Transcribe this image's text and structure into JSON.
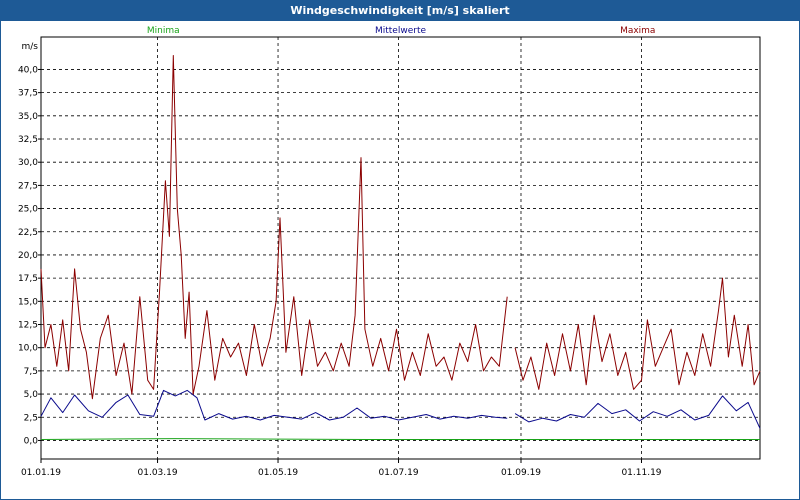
{
  "window": {
    "title": "Windgeschwindigkeit [m/s] skaliert"
  },
  "chart_data": {
    "type": "line",
    "title": "Windgeschwindigkeit [m/s] skaliert",
    "ylabel": "m/s",
    "xlabel": "",
    "ylim": [
      -2.0,
      43.5
    ],
    "xlim": [
      "2019-01-01",
      "2019-12-31"
    ],
    "yticks": [
      "0,0",
      "2,5",
      "5,0",
      "7,5",
      "10,0",
      "12,5",
      "15,0",
      "17,5",
      "20,0",
      "22,5",
      "25,0",
      "27,5",
      "30,0",
      "32,5",
      "35,0",
      "37,5",
      "40,0"
    ],
    "xticks": [
      {
        "date": "2019-01-01",
        "label": "01.01.19"
      },
      {
        "date": "2019-03-01",
        "label": "01.03.19"
      },
      {
        "date": "2019-05-01",
        "label": "01.05.19"
      },
      {
        "date": "2019-07-01",
        "label": "01.07.19"
      },
      {
        "date": "2019-09-01",
        "label": "01.09.19"
      },
      {
        "date": "2019-11-01",
        "label": "01.11.19"
      }
    ],
    "grid": true,
    "legend_placement": "top",
    "series": [
      {
        "name": "Minima",
        "color": "#1aa31a",
        "points": [
          [
            "2019-01-01",
            0.1
          ],
          [
            "2019-03-10",
            0.2
          ],
          [
            "2019-06-15",
            0.1
          ],
          [
            "2019-09-20",
            0.1
          ],
          [
            "2019-12-31",
            0.1
          ]
        ]
      },
      {
        "name": "Mittelwerte",
        "color": "#0a0a8c",
        "points": [
          [
            "2019-01-01",
            2.6
          ],
          [
            "2019-01-06",
            4.6
          ],
          [
            "2019-01-12",
            3.0
          ],
          [
            "2019-01-18",
            4.9
          ],
          [
            "2019-01-25",
            3.2
          ],
          [
            "2019-02-01",
            2.5
          ],
          [
            "2019-02-08",
            4.1
          ],
          [
            "2019-02-14",
            4.9
          ],
          [
            "2019-02-20",
            2.8
          ],
          [
            "2019-02-27",
            2.6
          ],
          [
            "2019-03-04",
            5.4
          ],
          [
            "2019-03-10",
            4.8
          ],
          [
            "2019-03-16",
            5.4
          ],
          [
            "2019-03-21",
            4.6
          ],
          [
            "2019-03-25",
            2.2
          ],
          [
            "2019-04-01",
            2.9
          ],
          [
            "2019-04-08",
            2.3
          ],
          [
            "2019-04-15",
            2.6
          ],
          [
            "2019-04-22",
            2.2
          ],
          [
            "2019-04-29",
            2.7
          ],
          [
            "2019-05-06",
            2.5
          ],
          [
            "2019-05-13",
            2.3
          ],
          [
            "2019-05-20",
            3.0
          ],
          [
            "2019-05-27",
            2.2
          ],
          [
            "2019-06-03",
            2.5
          ],
          [
            "2019-06-10",
            3.5
          ],
          [
            "2019-06-17",
            2.4
          ],
          [
            "2019-06-24",
            2.6
          ],
          [
            "2019-07-01",
            2.2
          ],
          [
            "2019-07-08",
            2.5
          ],
          [
            "2019-07-15",
            2.8
          ],
          [
            "2019-07-22",
            2.3
          ],
          [
            "2019-07-29",
            2.6
          ],
          [
            "2019-08-05",
            2.4
          ],
          [
            "2019-08-12",
            2.7
          ],
          [
            "2019-08-19",
            2.5
          ],
          [
            "2019-08-25",
            2.4
          ],
          [
            "2019-08-27",
            null
          ],
          [
            "2019-08-29",
            2.9
          ],
          [
            "2019-09-05",
            2.0
          ],
          [
            "2019-09-12",
            2.4
          ],
          [
            "2019-09-19",
            2.1
          ],
          [
            "2019-09-26",
            2.8
          ],
          [
            "2019-10-03",
            2.5
          ],
          [
            "2019-10-10",
            4.0
          ],
          [
            "2019-10-17",
            2.9
          ],
          [
            "2019-10-24",
            3.3
          ],
          [
            "2019-10-31",
            2.1
          ],
          [
            "2019-11-07",
            3.1
          ],
          [
            "2019-11-14",
            2.6
          ],
          [
            "2019-11-21",
            3.3
          ],
          [
            "2019-11-28",
            2.2
          ],
          [
            "2019-12-05",
            2.7
          ],
          [
            "2019-12-12",
            4.8
          ],
          [
            "2019-12-19",
            3.2
          ],
          [
            "2019-12-25",
            4.1
          ],
          [
            "2019-12-31",
            1.3
          ]
        ]
      },
      {
        "name": "Maxima",
        "color": "#8b0000",
        "points": [
          [
            "2019-01-01",
            18.5
          ],
          [
            "2019-01-03",
            10.0
          ],
          [
            "2019-01-06",
            12.5
          ],
          [
            "2019-01-09",
            8.0
          ],
          [
            "2019-01-12",
            13.0
          ],
          [
            "2019-01-15",
            7.5
          ],
          [
            "2019-01-18",
            18.5
          ],
          [
            "2019-01-21",
            12.0
          ],
          [
            "2019-01-24",
            9.5
          ],
          [
            "2019-01-27",
            4.5
          ],
          [
            "2019-01-31",
            11.0
          ],
          [
            "2019-02-04",
            13.5
          ],
          [
            "2019-02-08",
            7.0
          ],
          [
            "2019-02-12",
            10.5
          ],
          [
            "2019-02-16",
            5.0
          ],
          [
            "2019-02-20",
            15.5
          ],
          [
            "2019-02-24",
            6.5
          ],
          [
            "2019-02-27",
            5.5
          ],
          [
            "2019-03-02",
            16.0
          ],
          [
            "2019-03-05",
            28.0
          ],
          [
            "2019-03-07",
            22.0
          ],
          [
            "2019-03-09",
            41.5
          ],
          [
            "2019-03-11",
            25.0
          ],
          [
            "2019-03-13",
            20.0
          ],
          [
            "2019-03-15",
            11.0
          ],
          [
            "2019-03-17",
            16.0
          ],
          [
            "2019-03-19",
            5.0
          ],
          [
            "2019-03-22",
            8.0
          ],
          [
            "2019-03-26",
            14.0
          ],
          [
            "2019-03-30",
            6.5
          ],
          [
            "2019-04-03",
            11.0
          ],
          [
            "2019-04-07",
            9.0
          ],
          [
            "2019-04-11",
            10.5
          ],
          [
            "2019-04-15",
            7.0
          ],
          [
            "2019-04-19",
            12.5
          ],
          [
            "2019-04-23",
            8.0
          ],
          [
            "2019-04-27",
            11.0
          ],
          [
            "2019-04-30",
            15.0
          ],
          [
            "2019-05-02",
            24.0
          ],
          [
            "2019-05-05",
            9.5
          ],
          [
            "2019-05-09",
            15.5
          ],
          [
            "2019-05-13",
            7.0
          ],
          [
            "2019-05-17",
            13.0
          ],
          [
            "2019-05-21",
            8.0
          ],
          [
            "2019-05-25",
            9.5
          ],
          [
            "2019-05-29",
            7.5
          ],
          [
            "2019-06-02",
            10.5
          ],
          [
            "2019-06-06",
            8.0
          ],
          [
            "2019-06-09",
            13.5
          ],
          [
            "2019-06-12",
            30.5
          ],
          [
            "2019-06-14",
            12.0
          ],
          [
            "2019-06-18",
            8.0
          ],
          [
            "2019-06-22",
            11.0
          ],
          [
            "2019-06-26",
            7.5
          ],
          [
            "2019-06-30",
            12.0
          ],
          [
            "2019-07-04",
            6.5
          ],
          [
            "2019-07-08",
            9.5
          ],
          [
            "2019-07-12",
            7.0
          ],
          [
            "2019-07-16",
            11.5
          ],
          [
            "2019-07-20",
            8.0
          ],
          [
            "2019-07-24",
            9.0
          ],
          [
            "2019-07-28",
            6.5
          ],
          [
            "2019-08-01",
            10.5
          ],
          [
            "2019-08-05",
            8.5
          ],
          [
            "2019-08-09",
            12.5
          ],
          [
            "2019-08-13",
            7.5
          ],
          [
            "2019-08-17",
            9.0
          ],
          [
            "2019-08-21",
            8.0
          ],
          [
            "2019-08-25",
            15.5
          ],
          [
            "2019-08-27",
            null
          ],
          [
            "2019-08-29",
            10.0
          ],
          [
            "2019-09-02",
            6.5
          ],
          [
            "2019-09-06",
            9.0
          ],
          [
            "2019-09-10",
            5.5
          ],
          [
            "2019-09-14",
            10.5
          ],
          [
            "2019-09-18",
            7.0
          ],
          [
            "2019-09-22",
            11.5
          ],
          [
            "2019-09-26",
            7.5
          ],
          [
            "2019-09-30",
            12.5
          ],
          [
            "2019-10-04",
            6.0
          ],
          [
            "2019-10-08",
            13.5
          ],
          [
            "2019-10-12",
            8.5
          ],
          [
            "2019-10-16",
            11.5
          ],
          [
            "2019-10-20",
            7.0
          ],
          [
            "2019-10-24",
            9.5
          ],
          [
            "2019-10-28",
            5.5
          ],
          [
            "2019-11-01",
            6.5
          ],
          [
            "2019-11-04",
            13.0
          ],
          [
            "2019-11-08",
            8.0
          ],
          [
            "2019-11-12",
            10.0
          ],
          [
            "2019-11-16",
            12.0
          ],
          [
            "2019-11-20",
            6.0
          ],
          [
            "2019-11-24",
            9.5
          ],
          [
            "2019-11-28",
            7.0
          ],
          [
            "2019-12-02",
            11.5
          ],
          [
            "2019-12-06",
            8.0
          ],
          [
            "2019-12-10",
            14.0
          ],
          [
            "2019-12-12",
            17.5
          ],
          [
            "2019-12-15",
            9.0
          ],
          [
            "2019-12-18",
            13.5
          ],
          [
            "2019-12-22",
            8.0
          ],
          [
            "2019-12-25",
            12.5
          ],
          [
            "2019-12-28",
            6.0
          ],
          [
            "2019-12-31",
            7.5
          ]
        ]
      }
    ]
  }
}
